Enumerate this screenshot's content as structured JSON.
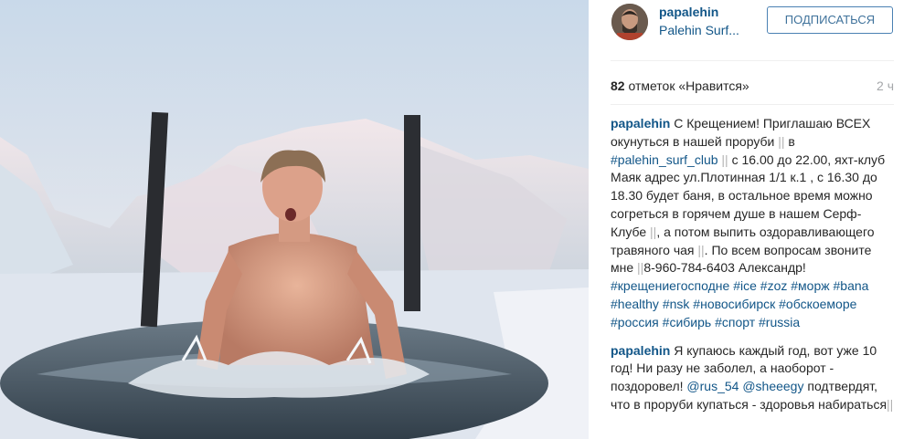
{
  "post": {
    "username": "papalehin",
    "sublink": "Palehin Surf...",
    "follow_label": "ПОДПИСАТЬСЯ",
    "likes_count": "82",
    "likes_label": " отметок «Нравится»",
    "time": "2 ч"
  },
  "caption": {
    "user": "papalehin",
    "t1": " С Крещением! Приглашаю ВСЕХ окунуться в нашей проруби ",
    "bar1": "||",
    "t2": " в ",
    "tag_club": "#palehin_surf_club",
    "bar2": " ||",
    "t3": " с 16.00 до 22.00, яхт-клуб Маяк адрес ул.Плотинная 1/1 к.1 , с 16.30 до 18.30 будет баня, в остальное время можно согреться в горячем душе в нашем Серф-Клубе ",
    "bar3": "||",
    "t4": ", а потом выпить оздоравливающего травяного чая ",
    "bar4": "||",
    "t5": ". По всем вопросам звоните мне ",
    "bar5": "||",
    "t6": "8-960-784-6403 Александр! ",
    "tags": [
      "#крещениегосподне",
      "#ice",
      "#zoz",
      "#морж",
      "#bana",
      "#healthy",
      "#nsk",
      "#новосибирск",
      "#обскоеморе",
      "#россия",
      "#сибирь",
      "#спорт",
      "#russia"
    ]
  },
  "comment2": {
    "user": "papalehin",
    "t1": " Я купаюсь каждый год, вот уже 10 год! Ни разу не заболел, а наоборот - поздоровел! ",
    "mention1": "@rus_54",
    "t2": " ",
    "mention2": "@sheeegy",
    "t3": " подтвердят, что в проруби купаться - здоровья набираться",
    "bar": "||"
  },
  "colors": {
    "link": "#125688",
    "button_text": "#3f729b",
    "muted": "#a5a7aa"
  }
}
